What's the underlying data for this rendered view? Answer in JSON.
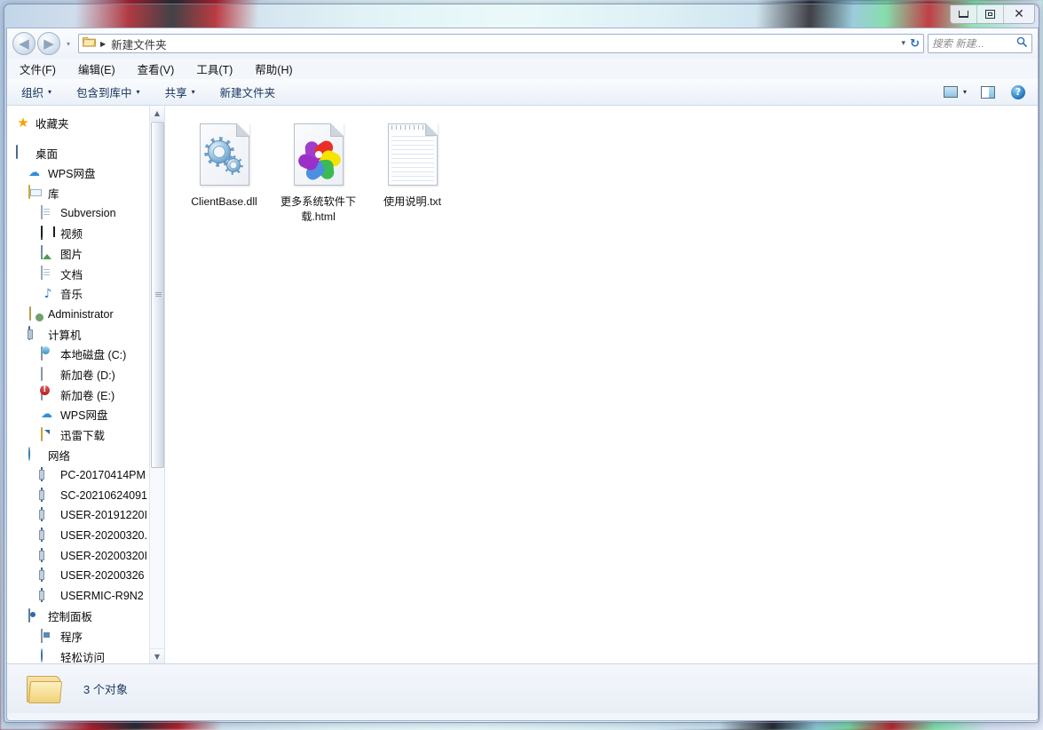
{
  "window": {
    "controls": {
      "minimize": "minimize",
      "maximize": "maximize",
      "close": "close"
    }
  },
  "navbar": {
    "back_glyph": "◀",
    "forward_glyph": "▶",
    "history_glyph": "▾",
    "breadcrumb_arrow": "▶",
    "breadcrumb_text": "新建文件夹",
    "dropdown_glyph": "▾",
    "refresh_glyph": "↻",
    "search_placeholder": "搜索 新建...",
    "search_value": "",
    "search_icon_glyph": "⌕"
  },
  "menubar": {
    "items": [
      {
        "label": "文件(F)"
      },
      {
        "label": "编辑(E)"
      },
      {
        "label": "查看(V)"
      },
      {
        "label": "工具(T)"
      },
      {
        "label": "帮助(H)"
      }
    ]
  },
  "toolbar": {
    "organize": "组织",
    "include_in_library": "包含到库中",
    "share": "共享",
    "new_folder": "新建文件夹",
    "caret": "▾",
    "help_glyph": "?"
  },
  "sidebar": {
    "scroll": {
      "up_glyph": "▲",
      "down_glyph": "▼"
    },
    "items": [
      {
        "label": "收藏夹",
        "icon": "star-icon",
        "indent": 0
      },
      {
        "label": "桌面",
        "icon": "desktop-icon",
        "indent": 0
      },
      {
        "label": "WPS网盘",
        "icon": "cloud-icon",
        "indent": 1
      },
      {
        "label": "库",
        "icon": "library-icon",
        "indent": 1
      },
      {
        "label": "Subversion",
        "icon": "document-icon",
        "indent": 2
      },
      {
        "label": "视频",
        "icon": "video-icon",
        "indent": 2
      },
      {
        "label": "图片",
        "icon": "picture-icon",
        "indent": 2
      },
      {
        "label": "文档",
        "icon": "document-icon",
        "indent": 2
      },
      {
        "label": "音乐",
        "icon": "music-icon",
        "indent": 2
      },
      {
        "label": "Administrator",
        "icon": "user-icon",
        "indent": 1
      },
      {
        "label": "计算机",
        "icon": "computer-icon",
        "indent": 1
      },
      {
        "label": "本地磁盘 (C:)",
        "icon": "harddisk-system-icon",
        "indent": 2
      },
      {
        "label": "新加卷 (D:)",
        "icon": "harddisk-icon",
        "indent": 2
      },
      {
        "label": "新加卷 (E:)",
        "icon": "harddisk-alert-icon",
        "indent": 2
      },
      {
        "label": "WPS网盘",
        "icon": "cloud-icon",
        "indent": 2
      },
      {
        "label": "迅雷下载",
        "icon": "thunder-download-icon",
        "indent": 2
      },
      {
        "label": "网络",
        "icon": "network-icon",
        "indent": 1
      },
      {
        "label": "PC-20170414PM",
        "icon": "network-computer-icon",
        "indent": 2
      },
      {
        "label": "SC-20210624091",
        "icon": "network-computer-icon",
        "indent": 2
      },
      {
        "label": "USER-20191220I",
        "icon": "network-computer-icon",
        "indent": 2
      },
      {
        "label": "USER-20200320.",
        "icon": "network-computer-icon",
        "indent": 2
      },
      {
        "label": "USER-20200320I",
        "icon": "network-computer-icon",
        "indent": 2
      },
      {
        "label": "USER-20200326",
        "icon": "network-computer-icon",
        "indent": 2
      },
      {
        "label": "USERMIC-R9N2",
        "icon": "network-computer-icon",
        "indent": 2
      },
      {
        "label": "控制面板",
        "icon": "control-panel-icon",
        "indent": 1
      },
      {
        "label": "程序",
        "icon": "programs-icon",
        "indent": 2
      },
      {
        "label": "轻松访问",
        "icon": "ease-of-access-icon",
        "indent": 2
      }
    ]
  },
  "files": [
    {
      "name": "ClientBase.dll",
      "icon": "dll-gear-icon"
    },
    {
      "name": "更多系统软件下载.html",
      "icon": "html-pinwheel-icon"
    },
    {
      "name": "使用说明.txt",
      "icon": "text-notepad-icon"
    }
  ],
  "statusbar": {
    "count_text": "3 个对象",
    "folder_icon": "folder-icon"
  },
  "colors": {
    "accent": "#2f6fb5",
    "pinwheel": [
      "#a13ccd",
      "#e8302a",
      "#f5e400",
      "#3cba54",
      "#4c8fe0",
      "#9b30c8"
    ]
  }
}
